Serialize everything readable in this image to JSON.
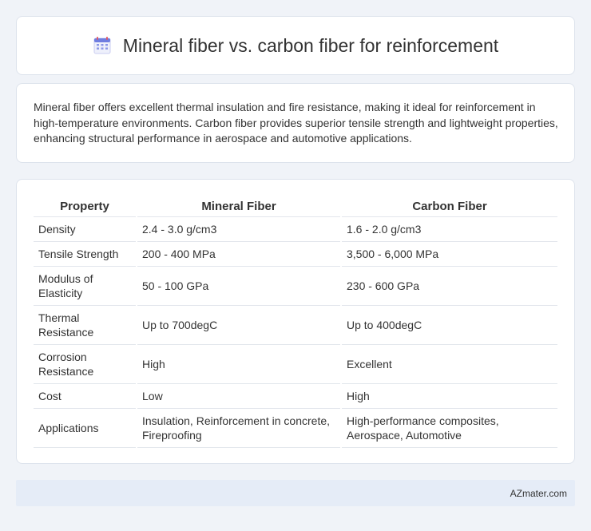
{
  "header": {
    "title": "Mineral fiber vs. carbon fiber for reinforcement",
    "icon": "calendar-icon"
  },
  "intro": {
    "text": "Mineral fiber offers excellent thermal insulation and fire resistance, making it ideal for reinforcement in high-temperature environments. Carbon fiber provides superior tensile strength and lightweight properties, enhancing structural performance in aerospace and automotive applications."
  },
  "table": {
    "headers": [
      "Property",
      "Mineral Fiber",
      "Carbon Fiber"
    ],
    "rows": [
      [
        "Density",
        "2.4 - 3.0 g/cm3",
        "1.6 - 2.0 g/cm3"
      ],
      [
        "Tensile Strength",
        "200 - 400 MPa",
        "3,500 - 6,000 MPa"
      ],
      [
        "Modulus of Elasticity",
        "50 - 100 GPa",
        "230 - 600 GPa"
      ],
      [
        "Thermal Resistance",
        "Up to 700degC",
        "Up to 400degC"
      ],
      [
        "Corrosion Resistance",
        "High",
        "Excellent"
      ],
      [
        "Cost",
        "Low",
        "High"
      ],
      [
        "Applications",
        "Insulation, Reinforcement in concrete, Fireproofing",
        "High-performance composites, Aerospace, Automotive"
      ]
    ]
  },
  "footer": {
    "text": "AZmater.com"
  },
  "colors": {
    "page_background": "#f0f3f8",
    "card_background": "#ffffff",
    "footer_background": "#e5ecf7",
    "text": "#333333"
  }
}
